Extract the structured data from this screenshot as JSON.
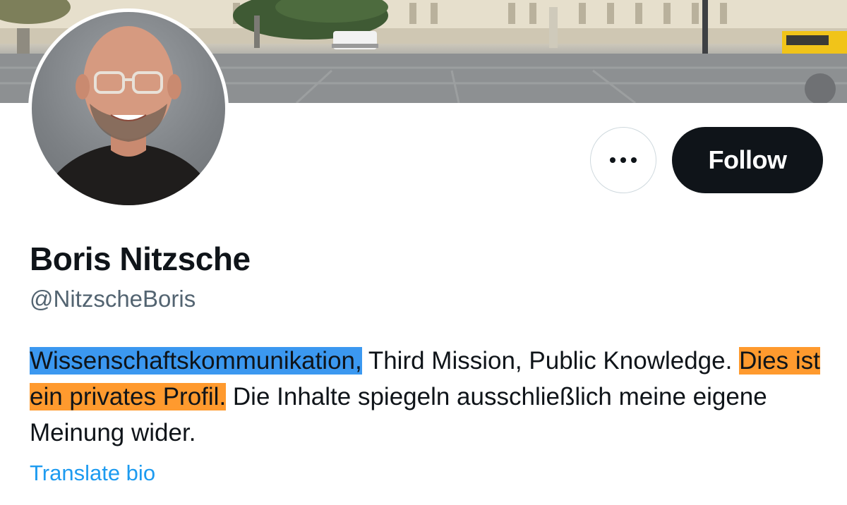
{
  "profile": {
    "display_name": "Boris Nitzsche",
    "handle": "@NitzscheBoris"
  },
  "bio": {
    "seg1": "Wissenschaftskommunikation,",
    "seg2": " Third Mission, Public Knowledge.  ",
    "seg3": "Dies ist ein privates Profil.",
    "seg4": " Die Inhalte spiegeln ausschließlich meine eigene Meinung wider."
  },
  "actions": {
    "follow_label": "Follow",
    "more_icon": "more-horizontal-icon",
    "translate_label": "Translate bio"
  },
  "colors": {
    "follow_bg": "#0f1419",
    "highlight_blue": "#3b98f0",
    "highlight_orange": "#ff9a2e",
    "link": "#1d9bf0",
    "handle_gray": "#536471"
  }
}
